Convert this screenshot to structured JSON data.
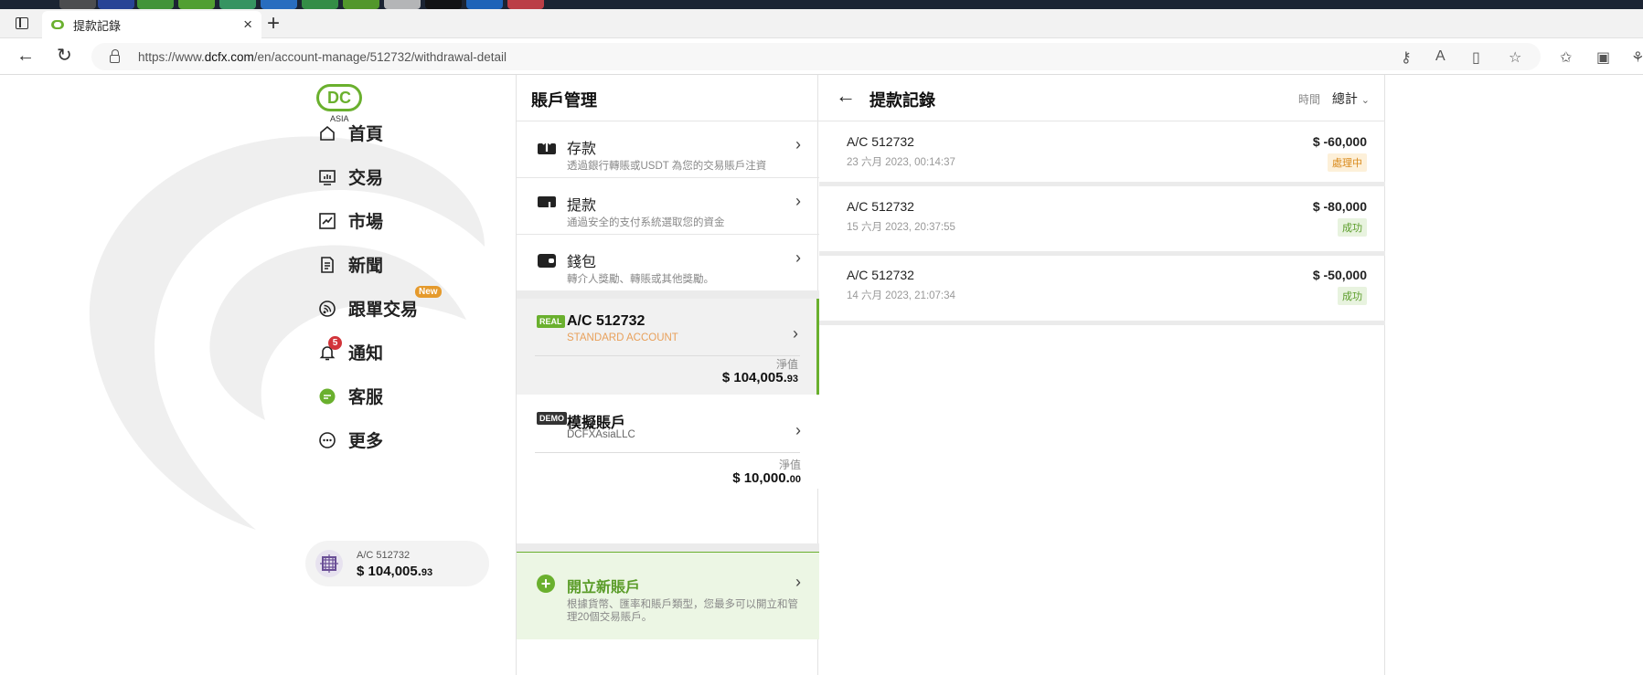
{
  "browser": {
    "tab_title": "提款記錄",
    "tab_close": "×",
    "new_tab": "+",
    "url_base": "https://www.",
    "url_domain": "dcfx.com",
    "url_path": "/en/account-manage/512732/withdrawal-detail"
  },
  "logo": {
    "mark": "DC",
    "sub": "ASIA"
  },
  "sidebar": {
    "items": [
      {
        "label": "首頁",
        "icon": "home-icon"
      },
      {
        "label": "交易",
        "icon": "trade-icon"
      },
      {
        "label": "市場",
        "icon": "market-chart-icon"
      },
      {
        "label": "新聞",
        "icon": "news-icon"
      },
      {
        "label": "跟單交易",
        "icon": "copy-trade-icon",
        "badge": "New"
      },
      {
        "label": "通知",
        "icon": "bell-icon",
        "badge": "5"
      },
      {
        "label": "客服",
        "icon": "chat-icon"
      },
      {
        "label": "更多",
        "icon": "more-icon"
      }
    ],
    "account": {
      "label": "A/C 512732",
      "balance_main": "$ 104,005.",
      "balance_cents": "93"
    }
  },
  "account_manage": {
    "title": "賬戶管理",
    "actions": [
      {
        "title": "存款",
        "desc": "透過銀行轉賬或USDT 為您的交易賬戶注資",
        "icon": "deposit-icon"
      },
      {
        "title": "提款",
        "desc": "通過安全的支付系統選取您的資金",
        "icon": "withdraw-icon"
      },
      {
        "title": "錢包",
        "desc": "轉介人獎勵、轉賬或其他獎勵。",
        "icon": "wallet-icon"
      }
    ],
    "accounts": [
      {
        "tag": "REAL",
        "name": "A/C 512732",
        "sub": "STANDARD ACCOUNT",
        "net_label": "淨值",
        "net_main": "$ 104,005.",
        "net_cents": "93"
      },
      {
        "tag": "DEMO",
        "name": "模擬賬戶",
        "sub": "DCFXAsiaLLC",
        "net_label": "淨值",
        "net_main": "$ 10,000.",
        "net_cents": "00"
      }
    ],
    "new_account": {
      "title": "開立新賬戶",
      "desc": "根據貨幣、匯率和賬戶類型，您最多可以開立和管理20個交易賬戶。"
    }
  },
  "withdrawals": {
    "title": "提款記錄",
    "filter_label": "時間",
    "filter_value": "總計",
    "rows": [
      {
        "account": "A/C 512732",
        "date": "23 六月 2023, 00:14:37",
        "amount": "$ -60,000",
        "status": "處理中",
        "status_type": "proc"
      },
      {
        "account": "A/C 512732",
        "date": "15 六月 2023, 20:37:55",
        "amount": "$ -80,000",
        "status": "成功",
        "status_type": "ok"
      },
      {
        "account": "A/C 512732",
        "date": "14 六月 2023, 21:07:34",
        "amount": "$ -50,000",
        "status": "成功",
        "status_type": "ok"
      }
    ]
  },
  "colors": {
    "brand_green": "#6ab02e",
    "warning": "#d98a1c",
    "badge_red": "#d2343a"
  }
}
